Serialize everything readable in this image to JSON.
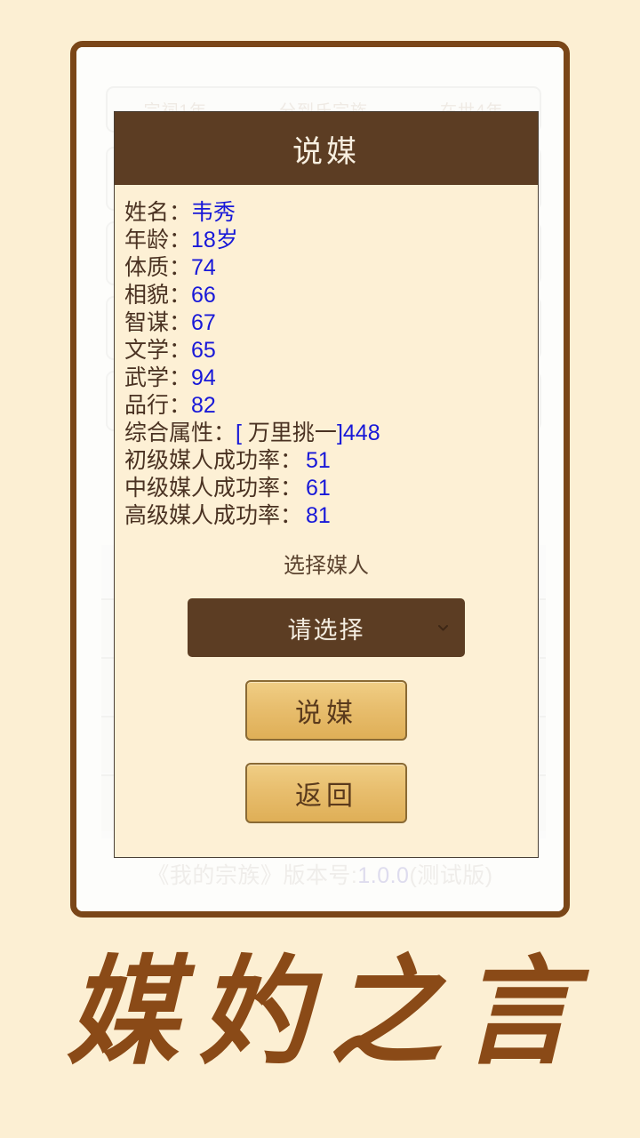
{
  "app": {
    "brush_title": "媒妁之言"
  },
  "background": {
    "tabs": [
      "宗祠1年",
      "分到氏宗族",
      "在世4年"
    ],
    "footer_prefix": "《我的宗族》版本号:",
    "footer_version": "1.0.0",
    "footer_suffix": "(测试版)"
  },
  "modal": {
    "title": "说媒",
    "attributes": [
      {
        "label": "姓名：",
        "value": "韦秀"
      },
      {
        "label": "年龄：",
        "value": "18岁"
      },
      {
        "label": "体质：",
        "value": "74"
      },
      {
        "label": "相貌：",
        "value": "66"
      },
      {
        "label": "智谋：",
        "value": "67"
      },
      {
        "label": "文学：",
        "value": "65"
      },
      {
        "label": "武学：",
        "value": "94"
      },
      {
        "label": "品行：",
        "value": "82"
      }
    ],
    "composite": {
      "label": "综合属性：",
      "open_bracket": "[ ",
      "grade": "万里挑一",
      "close_bracket": "]",
      "total": "448"
    },
    "rates": [
      {
        "label": "初级媒人成功率：",
        "value": "51"
      },
      {
        "label": "中级媒人成功率：",
        "value": "61"
      },
      {
        "label": "高级媒人成功率：",
        "value": "81"
      }
    ],
    "select_section_label": "选择媒人",
    "dropdown": {
      "selected": "请选择",
      "icon": "chevron-down-icon"
    },
    "primary_button": "说媒",
    "back_button": "返回"
  },
  "colors": {
    "page_bg": "#FCEFD3",
    "frame_border": "#7A4618",
    "modal_bg": "#FDF0D5",
    "header_brown": "#5C3D23",
    "value_blue": "#1818D8",
    "gold_button": "#E8BE6E",
    "brush_brown": "#8A4A17"
  }
}
